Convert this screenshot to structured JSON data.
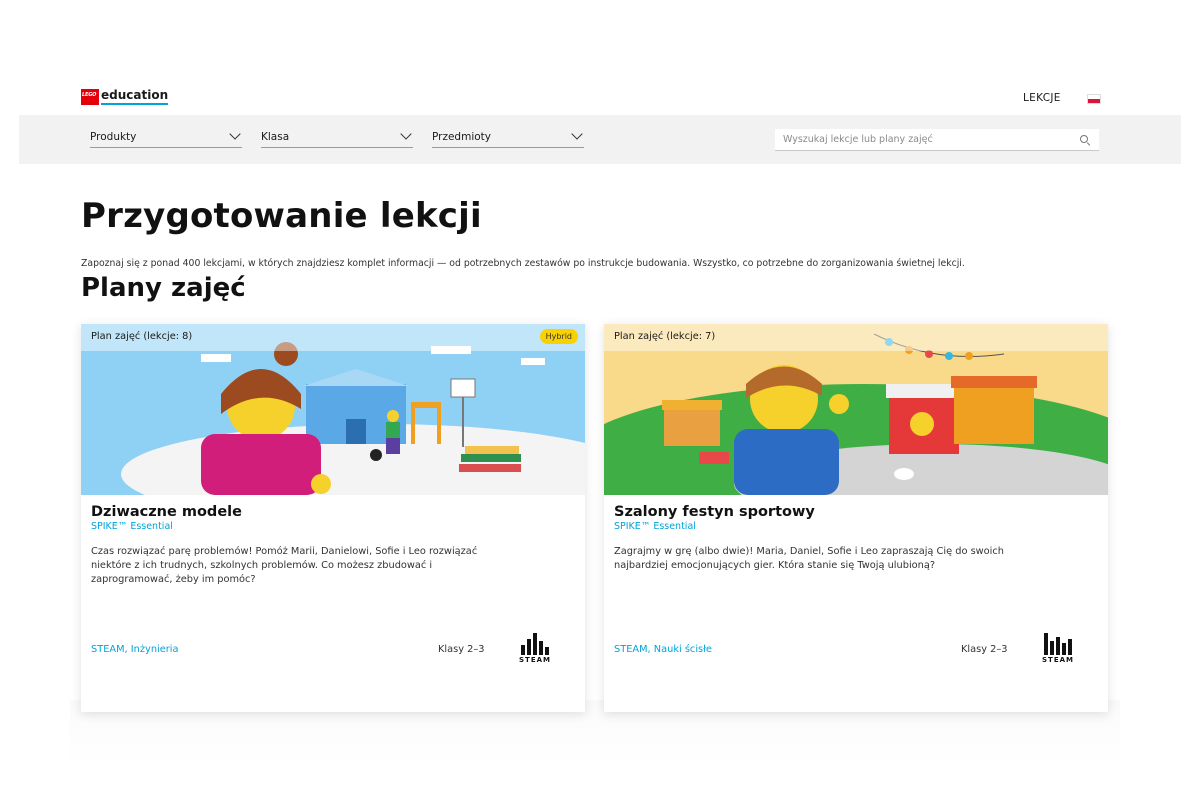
{
  "header": {
    "logo_mark": "LEGO",
    "logo_text": "education",
    "nav_lessons": "LEKCJE",
    "flag": "flag-poland-icon"
  },
  "filters": [
    {
      "label": "Produkty"
    },
    {
      "label": "Klasa"
    },
    {
      "label": "Przedmioty"
    }
  ],
  "search": {
    "placeholder": "Wyszukaj lekcje lub plany zajęć"
  },
  "page": {
    "title": "Przygotowanie lekcji",
    "intro": "Zapoznaj się z ponad 400 lekcjami, w których znajdziesz komplet informacji — od potrzebnych zestawów po instrukcje budowania. Wszystko, co potrzebne do zorganizowania świetnej lekcji.",
    "section_title": "Plany zajęć"
  },
  "cards": [
    {
      "count": "Plan zajęć (lekcje: 8)",
      "badge": "Hybrid",
      "title": "Dziwaczne modele",
      "product": "SPIKE™ Essential",
      "description": "Czas rozwiązać parę problemów! Pomóż Marii, Danielowi, Sofie i Leo rozwiązać niektóre z ich trudnych, szkolnych problemów. Co możesz zbudować i zaprogramować, żeby im pomóc?",
      "subjects": "STEAM, Inżynieria",
      "grade": "Klasy 2–3",
      "steam_label": "STEAM"
    },
    {
      "count": "Plan zajęć (lekcje: 7)",
      "badge": "",
      "title": "Szalony festyn sportowy",
      "product": "SPIKE™ Essential",
      "description": "Zagrajmy w grę (albo dwie)! Maria, Daniel, Sofie i Leo zapraszają Cię do swoich najbardziej emocjonujących gier. Która stanie się Twoją ulubioną?",
      "subjects": "STEAM, Nauki ścisłe",
      "grade": "Klasy 2–3",
      "steam_label": "STEAM"
    }
  ],
  "colors": {
    "accent": "#00a3da",
    "lego_red": "#e3000b",
    "badge_yellow": "#f8d200",
    "filter_bg": "#f2f2f2"
  }
}
